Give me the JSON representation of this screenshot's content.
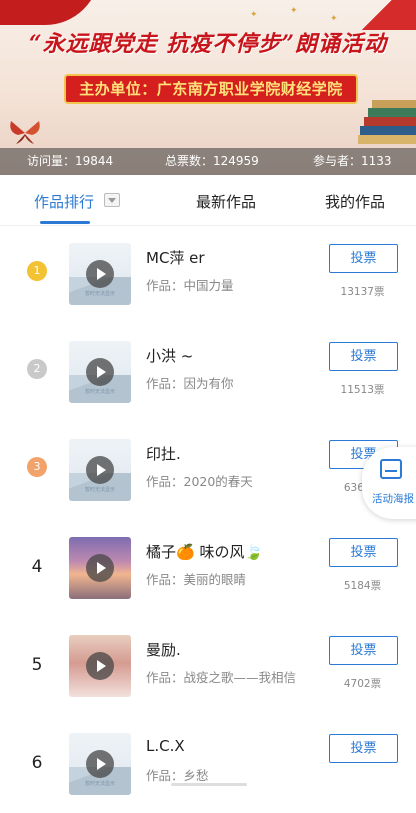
{
  "banner": {
    "slogan": "“永远跟党走 抗疫不停步”朗诵活动",
    "organizer": "主办单位：广东南方职业学院财经学院",
    "stats": {
      "visits_label": "访问量：19844",
      "total_votes_label": "总票数：124959",
      "participants_label": "参与者：1133"
    }
  },
  "tabs": {
    "ranking": "作品排行",
    "latest": "最新作品",
    "mine": "我的作品"
  },
  "thumb_caption": "暂时无法显示",
  "vote_label": "投票",
  "float_label": "活动海报",
  "entries": [
    {
      "rank": "1",
      "name": "MC萍 er",
      "work": "作品：中国力量",
      "votes": "13137票"
    },
    {
      "rank": "2",
      "name": "小洪 ~",
      "work": "作品：因为有你",
      "votes": "11513票"
    },
    {
      "rank": "3",
      "name": "印扗.",
      "work": "作品：2020的春天",
      "votes": "6360票"
    },
    {
      "rank": "4",
      "name": "橘子🍊 味の风🍃",
      "work": "作品：美丽的眼睛",
      "votes": "5184票"
    },
    {
      "rank": "5",
      "name": "曼励.",
      "work": "作品：战疫之歌——我相信",
      "votes": "4702票"
    },
    {
      "rank": "6",
      "name": "L.C.X",
      "work": "作品：乡愁",
      "votes": ""
    }
  ],
  "colors": {
    "accent": "#2a7ad6",
    "gold": "#f2c232",
    "silver": "#c9c9c9",
    "bronze": "#f2a36b"
  }
}
